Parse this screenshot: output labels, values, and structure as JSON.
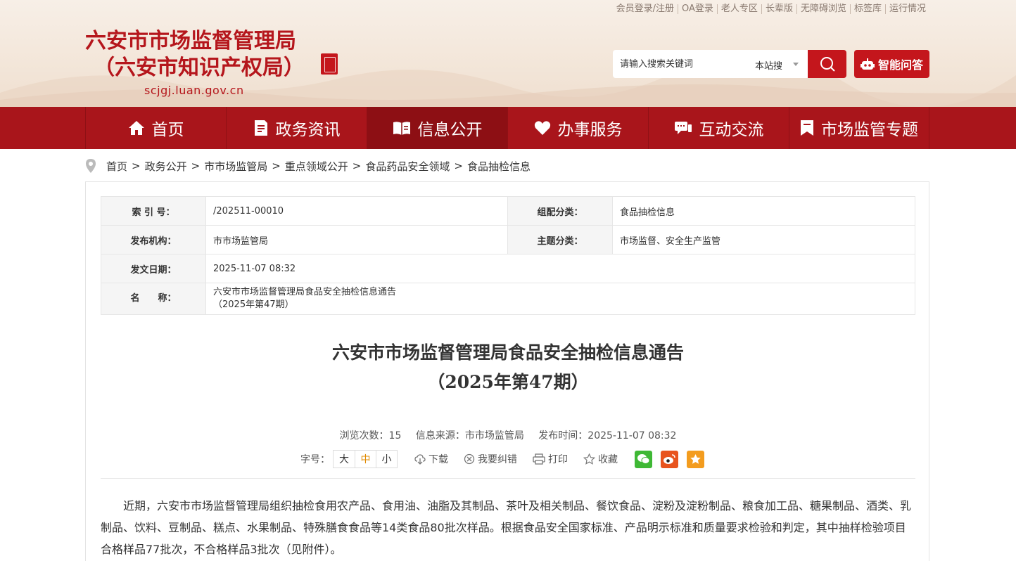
{
  "header": {
    "top_links": [
      "会员登录/注册",
      "OA登录",
      "老人专区",
      "长辈版",
      "无障碍浏览",
      "标签库",
      "运行情况"
    ],
    "title_line1": "六安市市场监督管理局",
    "title_line2": "（六安市知识产权局）",
    "url": "scjgj.luan.gov.cn",
    "search": {
      "placeholder": "请输入搜索关键词",
      "scope": "本站搜"
    },
    "ai_button": "智能问答"
  },
  "nav": {
    "items": [
      {
        "label": "首页",
        "icon": "home-icon"
      },
      {
        "label": "政务资讯",
        "icon": "document-icon"
      },
      {
        "label": "信息公开",
        "icon": "open-book-icon"
      },
      {
        "label": "办事服务",
        "icon": "heart-icon"
      },
      {
        "label": "互动交流",
        "icon": "chat-icon"
      },
      {
        "label": "市场监管专题",
        "icon": "bookmark-icon"
      }
    ],
    "active_index": 2
  },
  "breadcrumb": [
    "首页",
    "政务公开",
    "市市场监管局",
    "重点领域公开",
    "食品药品安全领域",
    "食品抽检信息"
  ],
  "meta": {
    "index_label": "索 引 号：",
    "index_value": "/202511-00010",
    "group_label": "组配分类：",
    "group_value": "食品抽检信息",
    "org_label": "发布机构：",
    "org_value": "市市场监管局",
    "topic_label": "主题分类：",
    "topic_value": "市场监督、安全生产监管",
    "date_label": "发文日期：",
    "date_value": "2025-11-07 08:32",
    "name_label": "名　　称：",
    "name_value_line1": "六安市市场监督管理局食品安全抽检信息通告",
    "name_value_line2": "（2025年第47期）"
  },
  "article": {
    "title_line1": "六安市市场监督管理局食品安全抽检信息通告",
    "title_line2": "（2025年第47期）",
    "views": "浏览次数：15",
    "source": "信息来源：市市场监管局",
    "published": "发布时间：2025-11-07 08:32",
    "font_size_label": "字号：",
    "font_sizes": [
      "大",
      "中",
      "小"
    ],
    "download": "下载",
    "report_error": "我要纠错",
    "print": "打印",
    "favorite": "收藏",
    "body": "近期，六安市市场监督管理局组织抽检食用农产品、食用油、油脂及其制品、茶叶及相关制品、餐饮食品、淀粉及淀粉制品、粮食加工品、糖果制品、酒类、乳制品、饮料、豆制品、糕点、水果制品、特殊膳食食品等14类食品80批次样品。根据食品安全国家标准、产品明示标准和质量要求检验和判定，其中抽样检验项目合格样品77批次，不合格样品3批次（见附件）。"
  },
  "colors": {
    "brand_red": "#c4161c",
    "nav_red": "#a9151b",
    "nav_active": "#8d0f14"
  }
}
